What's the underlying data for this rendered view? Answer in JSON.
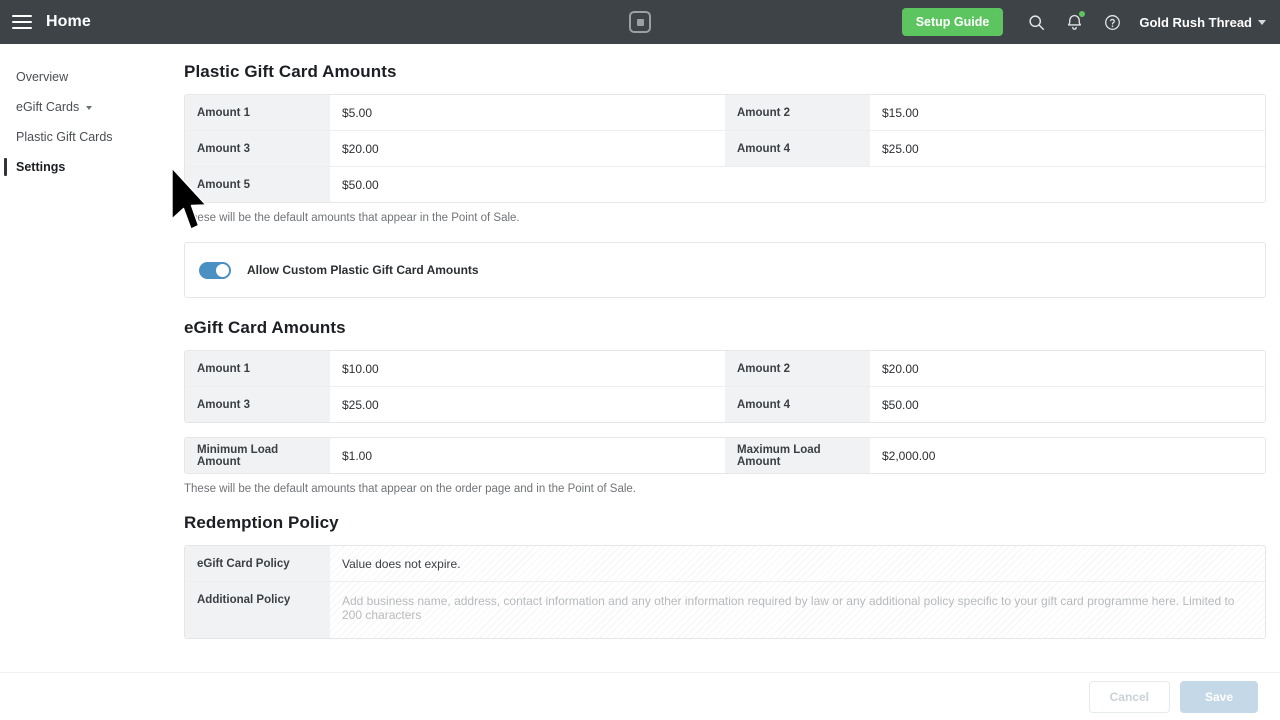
{
  "header": {
    "menu_icon": "hamburger-icon",
    "title": "Home",
    "logo_icon": "square-logo-icon",
    "setup_guide_label": "Setup Guide",
    "search_icon": "search-icon",
    "notifications_icon": "bell-icon",
    "help_icon": "help-circle-icon",
    "account_name": "Gold Rush Thread",
    "account_caret_icon": "chevron-down-icon",
    "bg_color": "#3e4347",
    "accent_green": "#5dc560"
  },
  "sidebar": {
    "items": [
      {
        "label": "Overview",
        "active": false,
        "has_chevron": false
      },
      {
        "label": "eGift Cards",
        "active": false,
        "has_chevron": true
      },
      {
        "label": "Plastic Gift Cards",
        "active": false,
        "has_chevron": false
      },
      {
        "label": "Settings",
        "active": true,
        "has_chevron": false
      }
    ]
  },
  "main": {
    "plastic_section": {
      "title": "Plastic Gift Card Amounts",
      "rows": [
        {
          "left_label": "Amount 1",
          "left_value": "$5.00",
          "right_label": "Amount 2",
          "right_value": "$15.00"
        },
        {
          "left_label": "Amount 3",
          "left_value": "$20.00",
          "right_label": "Amount 4",
          "right_value": "$25.00"
        },
        {
          "left_label": "Amount 5",
          "left_value": "$50.00",
          "right_label": "",
          "right_value": ""
        }
      ],
      "helper_text": "These will be the default amounts that appear in the Point of Sale."
    },
    "custom_amounts_toggle": {
      "label": "Allow Custom Plastic Gift Card Amounts",
      "enabled": true,
      "on_color": "#4a90c2"
    },
    "egift_section": {
      "title": "eGift Card Amounts",
      "rows": [
        {
          "left_label": "Amount 1",
          "left_value": "$10.00",
          "right_label": "Amount 2",
          "right_value": "$20.00"
        },
        {
          "left_label": "Amount 3",
          "left_value": "$25.00",
          "right_label": "Amount 4",
          "right_value": "$50.00"
        }
      ],
      "load_row": {
        "left_label": "Minimum Load Amount",
        "left_value": "$1.00",
        "right_label": "Maximum Load Amount",
        "right_value": "$2,000.00"
      },
      "helper_text": "These will be the default amounts that appear on the order page and in the Point of Sale."
    },
    "redemption_section": {
      "title": "Redemption Policy",
      "egift_policy_label": "eGift Card Policy",
      "egift_policy_value": "Value does not expire.",
      "additional_policy_label": "Additional Policy",
      "additional_policy_placeholder": "Add business name, address, contact information and any other information required by law or any additional policy specific to your gift card programme here. Limited to 200 characters"
    }
  },
  "footer": {
    "cancel_label": "Cancel",
    "save_label": "Save"
  }
}
